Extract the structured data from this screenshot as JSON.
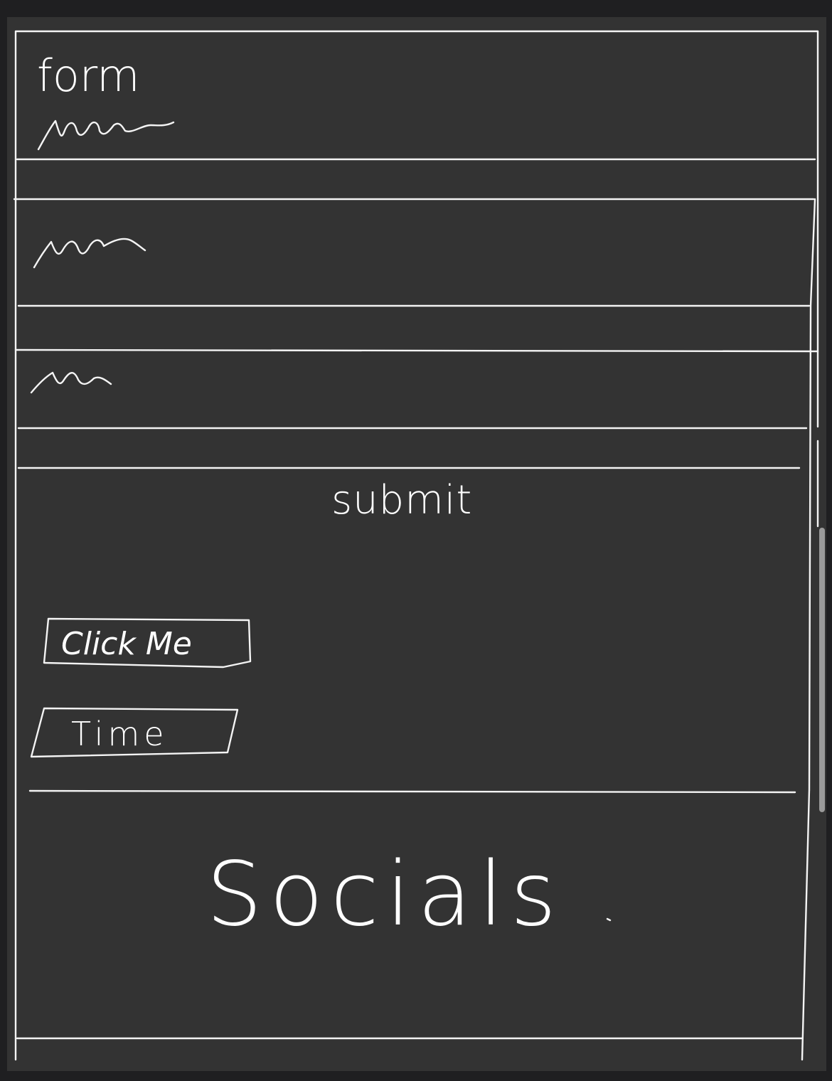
{
  "form": {
    "title": "form"
  },
  "submit": {
    "label": "submit"
  },
  "buttons": {
    "click_me": "Click Me",
    "time": "Time"
  },
  "footer": {
    "socials": "Socials"
  },
  "colors": {
    "background": "#333333",
    "ink": "#ffffff",
    "frame": "#1f1f21"
  }
}
